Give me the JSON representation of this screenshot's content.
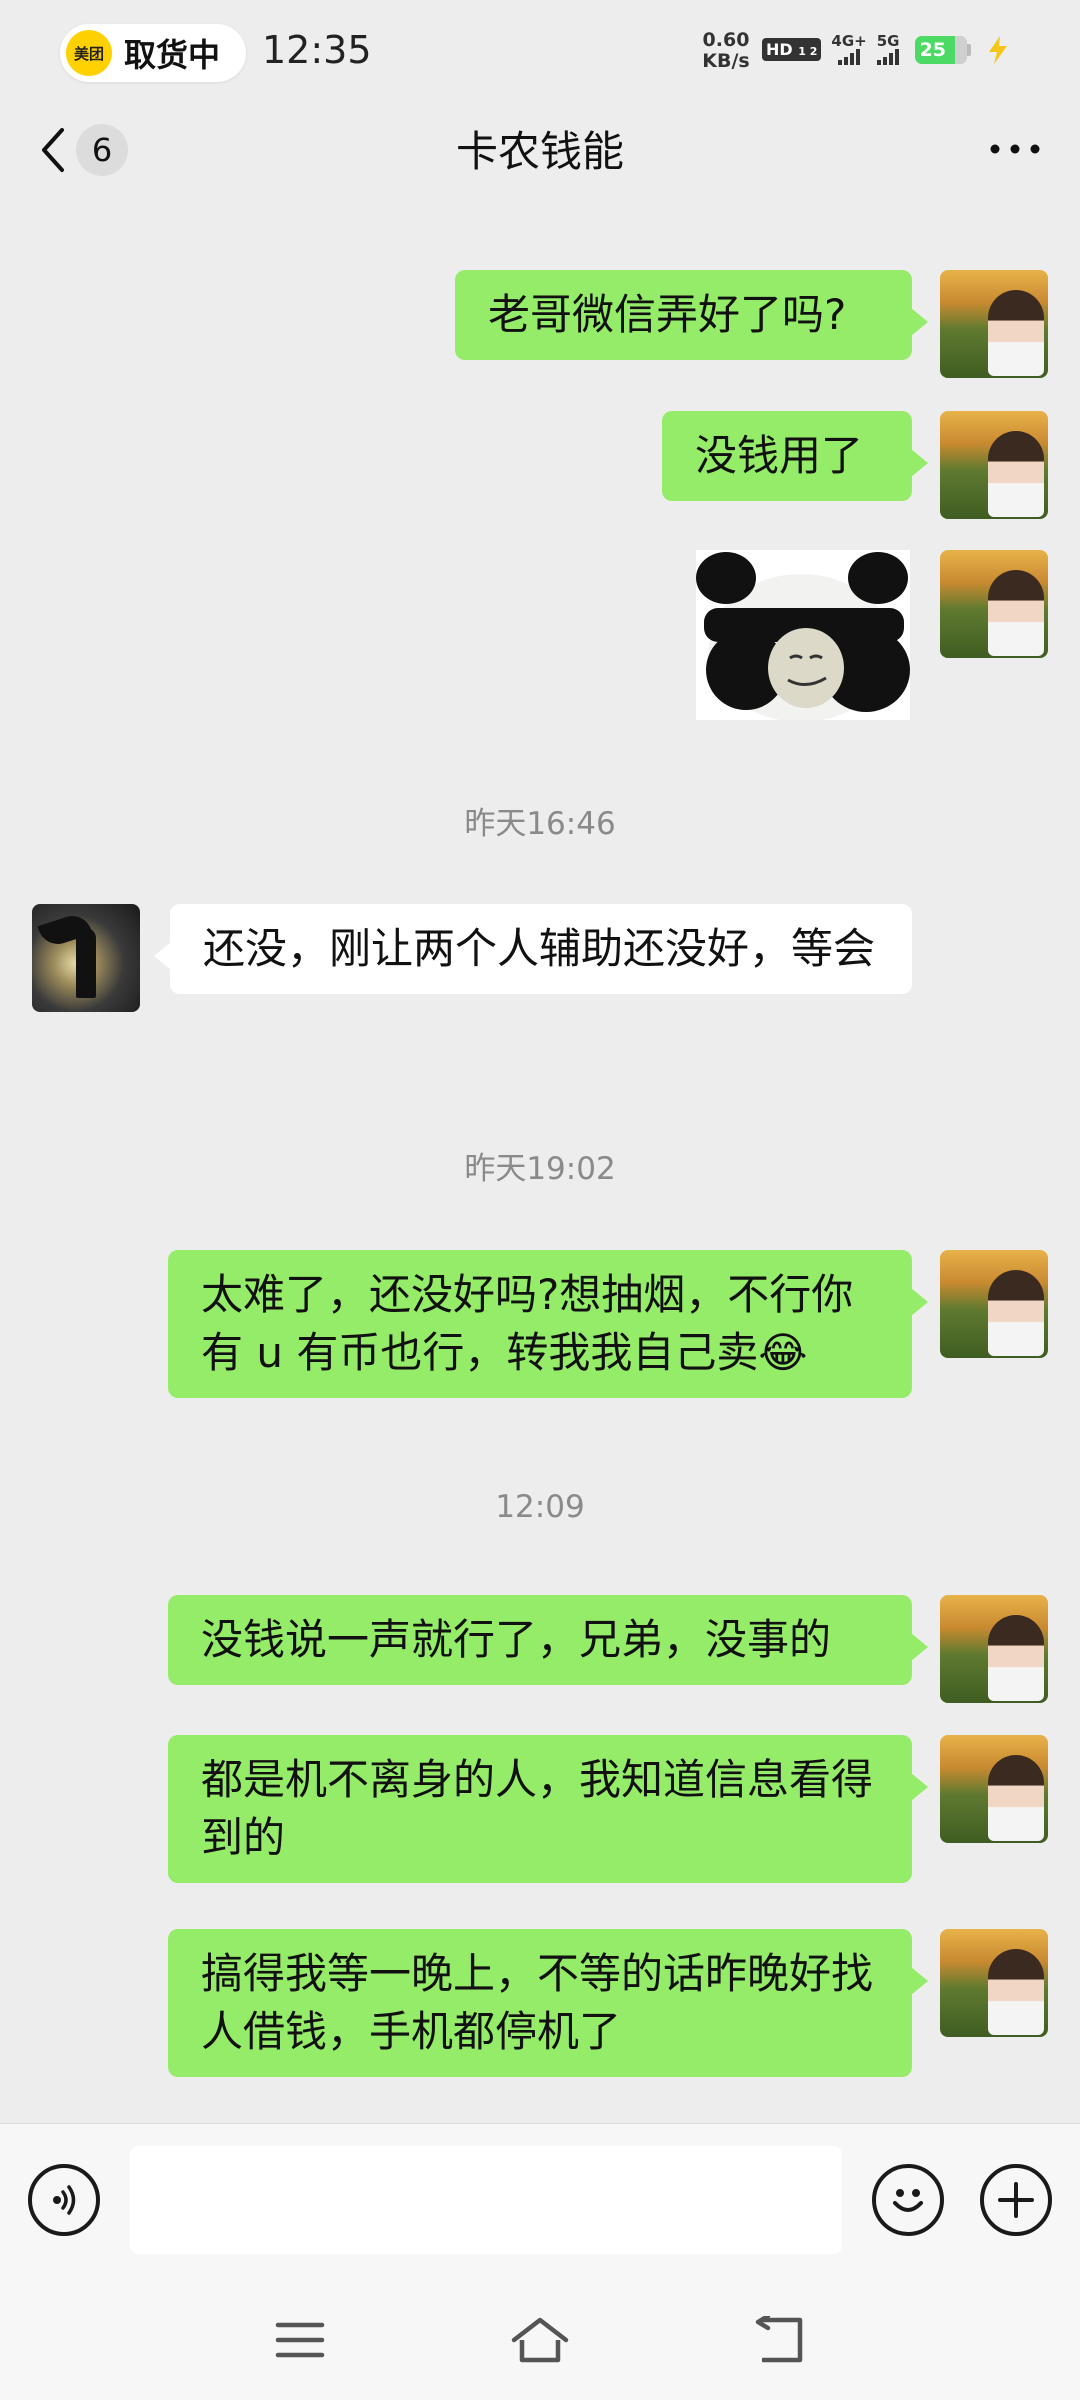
{
  "status_bar": {
    "app_pill_logo": "美团",
    "app_pill_text": "取货中",
    "time": "12:35",
    "net_speed_value": "0.60",
    "net_speed_unit": "KB/s",
    "hd_label": "HD",
    "hd_sim": "1 2",
    "network_1": "4G+",
    "network_2": "5G",
    "battery": "25",
    "icons": [
      "hd-icon",
      "signal-icon",
      "signal-icon",
      "battery-icon",
      "charging-icon"
    ]
  },
  "nav": {
    "unread_count": "6",
    "title": "卡农钱能",
    "icons": [
      "back-arrow-icon",
      "more-icon"
    ]
  },
  "messages": [
    {
      "sender": "me",
      "type": "text",
      "text": "老哥微信弄好了吗?"
    },
    {
      "sender": "me",
      "type": "text",
      "text": "没钱用了"
    },
    {
      "sender": "me",
      "type": "sticker",
      "sticker": "panda-face-sticker"
    },
    {
      "type": "timestamp",
      "text": "昨天16:46"
    },
    {
      "sender": "other",
      "type": "text",
      "text": "还没，刚让两个人辅助还没好，等会"
    },
    {
      "type": "timestamp",
      "text": "昨天19:02"
    },
    {
      "sender": "me",
      "type": "text",
      "text": "太难了，还没好吗?想抽烟，不行你有 u 有币也行，转我我自己卖😂"
    },
    {
      "type": "timestamp",
      "text": "12:09"
    },
    {
      "sender": "me",
      "type": "text",
      "text": "没钱说一声就行了，兄弟，没事的"
    },
    {
      "sender": "me",
      "type": "text",
      "text": "都是机不离身的人，我知道信息看得到的"
    },
    {
      "sender": "me",
      "type": "text",
      "text": "搞得我等一晚上，不等的话昨晚好找人借钱，手机都停机了"
    }
  ],
  "input_bar": {
    "value": "",
    "icons": [
      "voice-icon",
      "emoji-icon",
      "plus-icon"
    ]
  },
  "system_nav": {
    "icons": [
      "menu-icon",
      "home-icon",
      "back-icon"
    ]
  },
  "colors": {
    "background": "#ededed",
    "my_bubble": "#95ec69",
    "other_bubble": "#ffffff",
    "timestamp_text": "#8a8a8a",
    "battery": "#4cd964",
    "meituan_yellow": "#ffd100"
  }
}
